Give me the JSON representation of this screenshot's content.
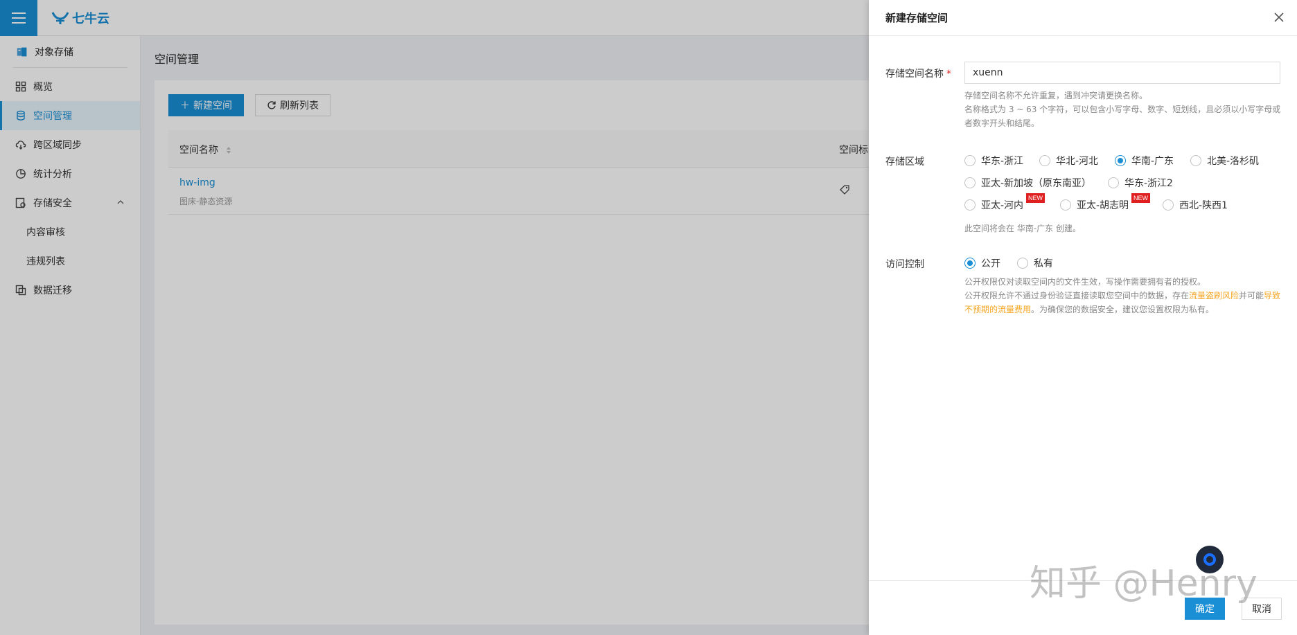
{
  "brand": {
    "logo_text": "七牛云",
    "accent": "#1a8fd6"
  },
  "sidebar": {
    "product": "对象存储",
    "items": [
      {
        "label": "概览"
      },
      {
        "label": "空间管理"
      },
      {
        "label": "跨区域同步"
      },
      {
        "label": "统计分析"
      },
      {
        "label": "存储安全"
      },
      {
        "label": "内容审核"
      },
      {
        "label": "违规列表"
      },
      {
        "label": "数据迁移"
      }
    ]
  },
  "main": {
    "title": "空间管理",
    "new_button": "新建空间",
    "refresh_button": "刷新列表",
    "columns": [
      "空间名称",
      "空间标"
    ],
    "rows": [
      {
        "name": "hw-img",
        "desc": "图床-静态资源"
      }
    ]
  },
  "drawer": {
    "title": "新建存储空间",
    "name_label": "存储空间名称",
    "required_mark": "*",
    "name_value": "xuenn",
    "name_hint_1": "存储空间名称不允许重复，遇到冲突请更换名称。",
    "name_hint_2": "名称格式为 3 ~ 63 个字符，可以包含小写字母、数字、短划线，且必须以小写字母或者数字开头和结尾。",
    "region_label": "存储区域",
    "regions": [
      {
        "label": "华东-浙江",
        "checked": false
      },
      {
        "label": "华北-河北",
        "checked": false
      },
      {
        "label": "华南-广东",
        "checked": true
      },
      {
        "label": "北美-洛杉矶",
        "checked": false
      },
      {
        "label": "亚太-新加坡（原东南亚）",
        "checked": false
      },
      {
        "label": "华东-浙江2",
        "checked": false
      },
      {
        "label": "亚太-河内",
        "checked": false,
        "badge": "NEW"
      },
      {
        "label": "亚太-胡志明",
        "checked": false,
        "badge": "NEW"
      },
      {
        "label": "西北-陕西1",
        "checked": false
      }
    ],
    "region_hint": "此空间将会在 华南-广东 创建。",
    "access_label": "访问控制",
    "access_options": [
      {
        "label": "公开",
        "checked": true
      },
      {
        "label": "私有",
        "checked": false
      }
    ],
    "access_hint_1": "公开权限仅对读取空间内的文件生效，写操作需要拥有者的授权。",
    "access_hint_2a": "公开权限允许不通过身份验证直接读取您空间中的数据，存在",
    "access_hint_2b": "流量盗刷风险",
    "access_hint_2c": "并可能",
    "access_hint_2d": "导致不预期的流量费用",
    "access_hint_2e": "。为确保您的数据安全，建议您设置权限为私有。",
    "confirm": "确定",
    "cancel": "取消"
  },
  "watermark": "知乎 @Henry"
}
